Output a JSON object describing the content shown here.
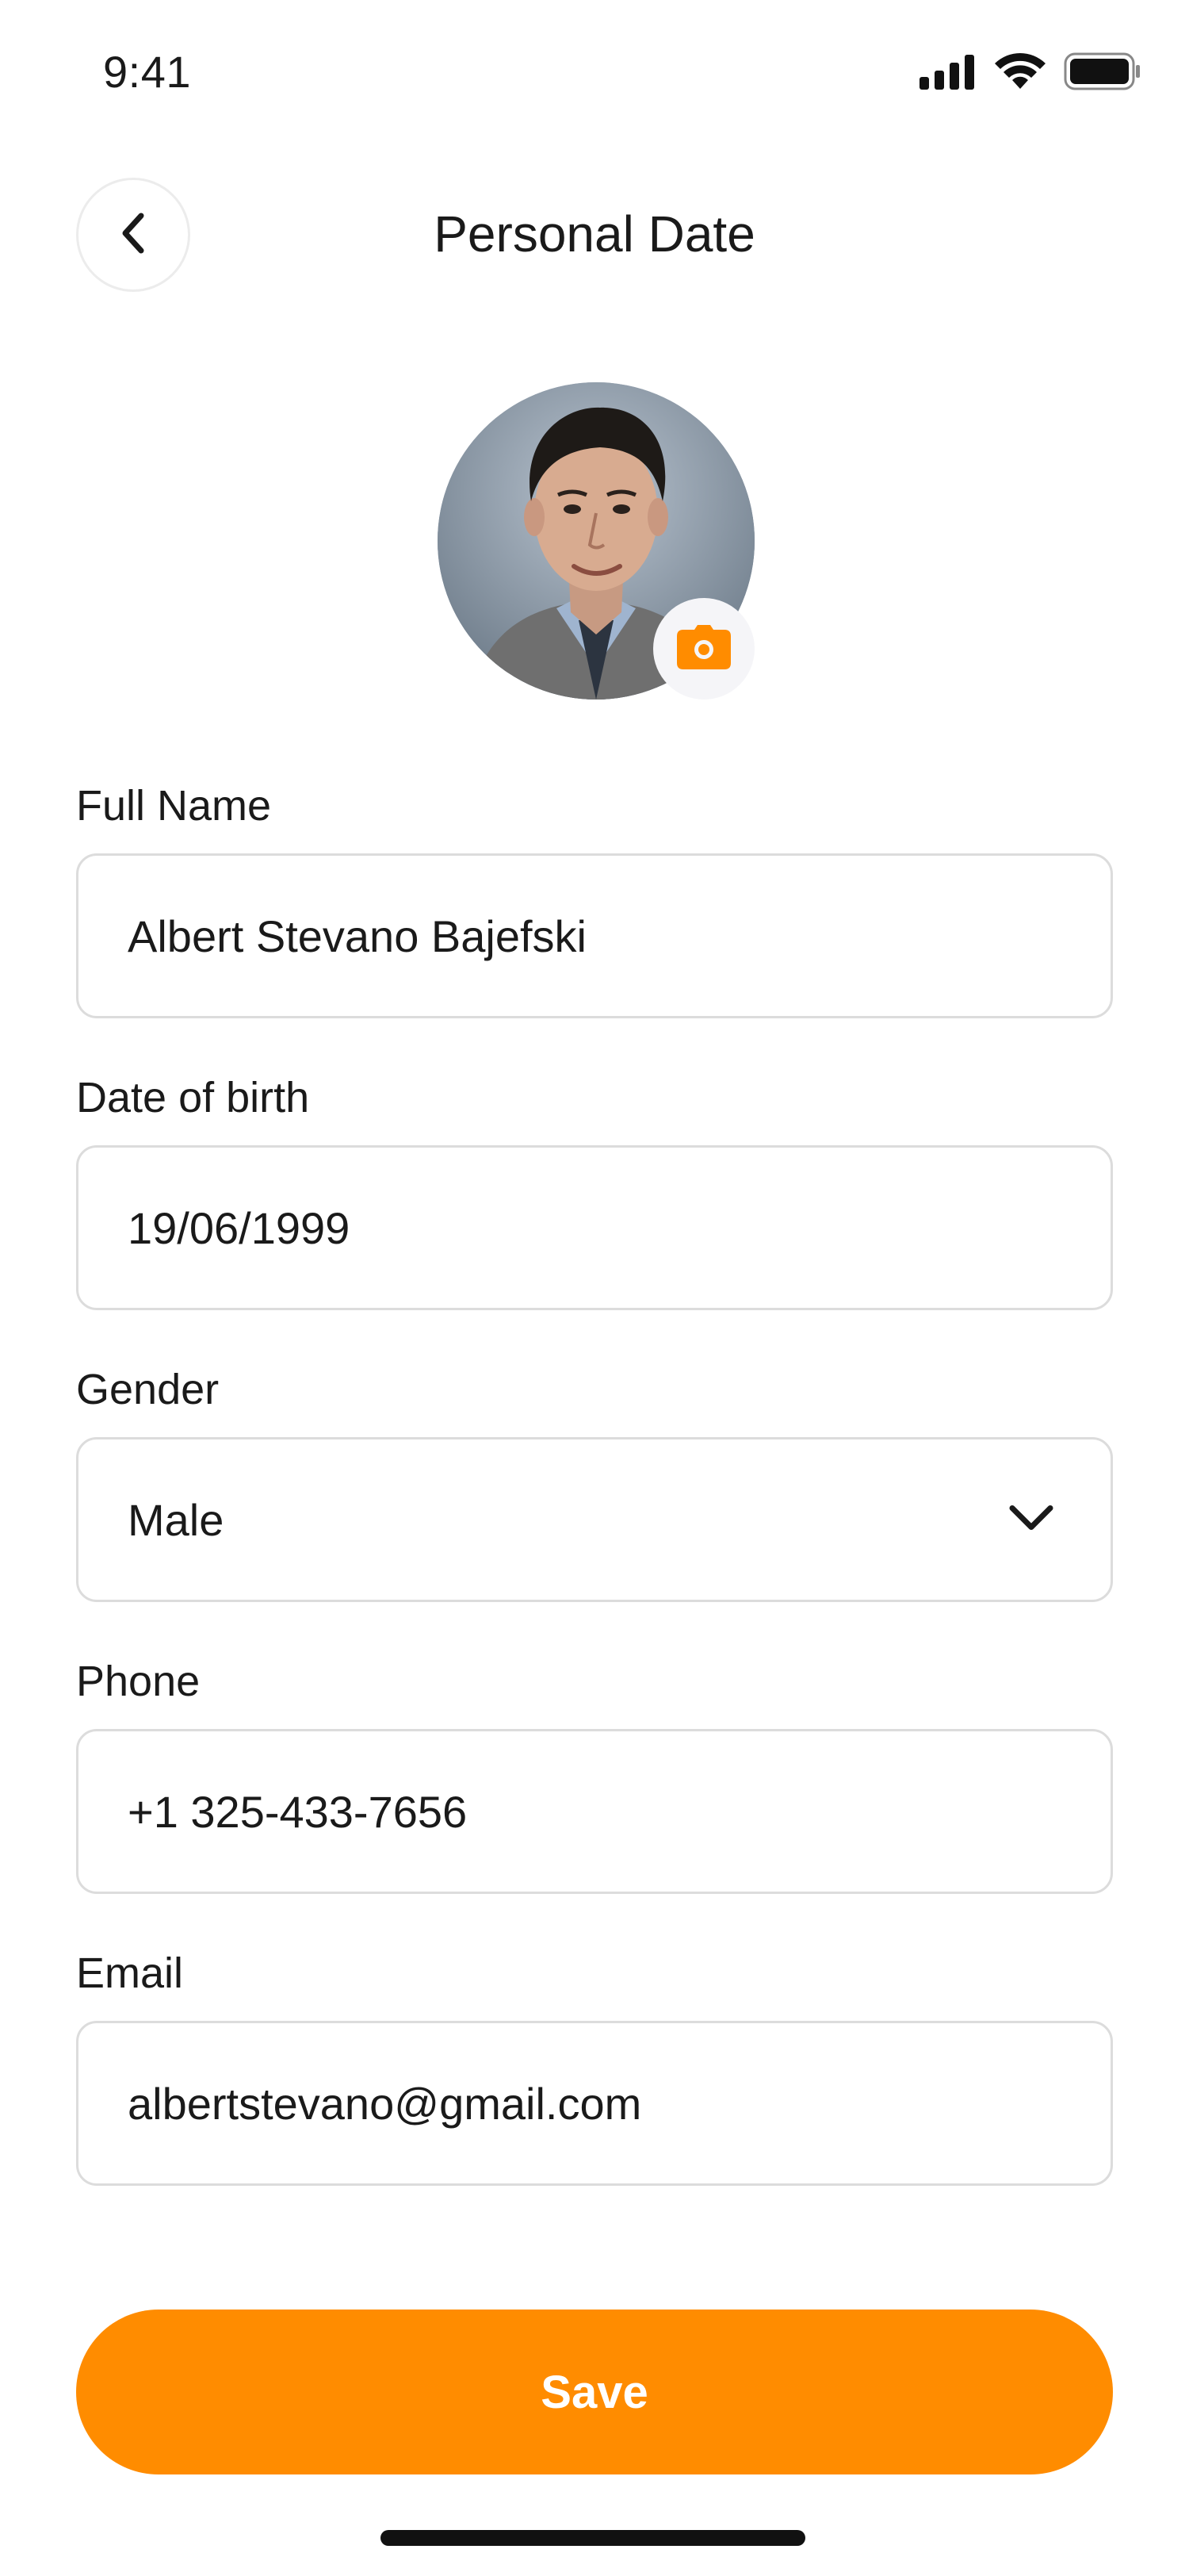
{
  "status_bar": {
    "time": "9:41"
  },
  "header": {
    "title": "Personal Date"
  },
  "fields": {
    "full_name": {
      "label": "Full Name",
      "value": "Albert Stevano Bajefski"
    },
    "date_of_birth": {
      "label": "Date of birth",
      "value": "19/06/1999"
    },
    "gender": {
      "label": "Gender",
      "value": "Male"
    },
    "phone": {
      "label": "Phone",
      "value": "+1 325-433-7656"
    },
    "email": {
      "label": "Email",
      "value": "albertstevano@gmail.com"
    }
  },
  "actions": {
    "save_label": "Save"
  },
  "icons": {
    "back": "chevron-left-icon",
    "camera": "camera-icon",
    "dropdown": "chevron-down-icon",
    "signal": "cellular-signal-icon",
    "wifi": "wifi-icon",
    "battery": "battery-icon"
  },
  "colors": {
    "accent": "#FF8C00",
    "field_border": "#DCDCDC",
    "text": "#1A1A1A",
    "background": "#FFFFFF"
  }
}
